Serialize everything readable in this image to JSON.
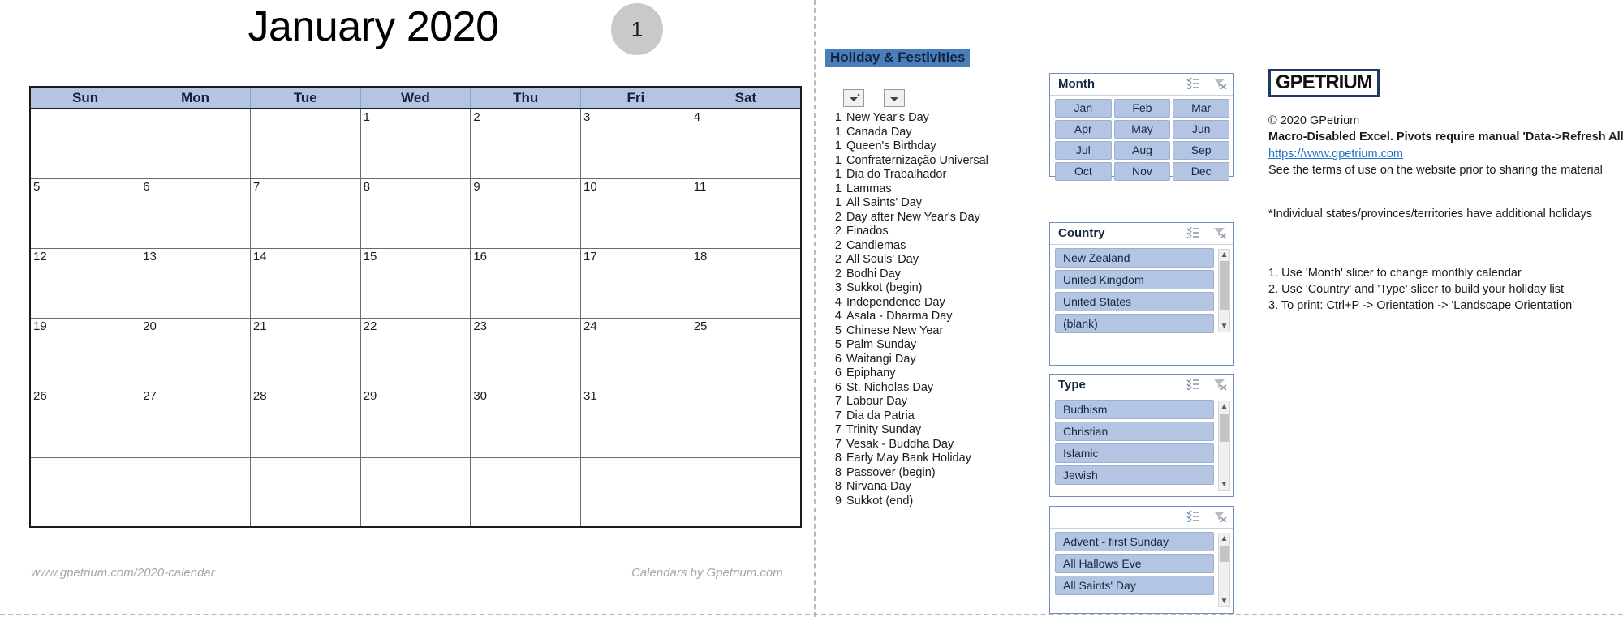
{
  "calendar": {
    "title": "January 2020",
    "month_number": "1",
    "weekday_headers": [
      "Sun",
      "Mon",
      "Tue",
      "Wed",
      "Thu",
      "Fri",
      "Sat"
    ],
    "weeks": [
      [
        "",
        "",
        "",
        "1",
        "2",
        "3",
        "4"
      ],
      [
        "5",
        "6",
        "7",
        "8",
        "9",
        "10",
        "11"
      ],
      [
        "12",
        "13",
        "14",
        "15",
        "16",
        "17",
        "18"
      ],
      [
        "19",
        "20",
        "21",
        "22",
        "23",
        "24",
        "25"
      ],
      [
        "26",
        "27",
        "28",
        "29",
        "30",
        "31",
        ""
      ],
      [
        "",
        "",
        "",
        "",
        "",
        "",
        ""
      ]
    ],
    "footer_left": "www.gpetrium.com/2020-calendar",
    "footer_right": "Calendars by Gpetrium.com"
  },
  "holidays": {
    "title": "Holiday & Festivities",
    "sort_filter_icon": "sort-filter-dropdown-icon",
    "filter_icon": "filter-dropdown-icon",
    "items": [
      {
        "day": "1",
        "name": "New Year's Day"
      },
      {
        "day": "1",
        "name": "Canada Day"
      },
      {
        "day": "1",
        "name": "Queen's Birthday"
      },
      {
        "day": "1",
        "name": "Confraternização Universal"
      },
      {
        "day": "1",
        "name": "Dia do Trabalhador"
      },
      {
        "day": "1",
        "name": "Lammas"
      },
      {
        "day": "1",
        "name": "All Saints' Day"
      },
      {
        "day": "2",
        "name": "Day after New Year's Day"
      },
      {
        "day": "2",
        "name": "Finados"
      },
      {
        "day": "2",
        "name": "Candlemas"
      },
      {
        "day": "2",
        "name": "All Souls' Day"
      },
      {
        "day": "2",
        "name": "Bodhi Day"
      },
      {
        "day": "3",
        "name": "Sukkot (begin)"
      },
      {
        "day": "4",
        "name": "Independence Day"
      },
      {
        "day": "4",
        "name": "Asala - Dharma Day"
      },
      {
        "day": "5",
        "name": "Chinese New Year"
      },
      {
        "day": "5",
        "name": "Palm Sunday"
      },
      {
        "day": "6",
        "name": "Waitangi Day"
      },
      {
        "day": "6",
        "name": "Epiphany"
      },
      {
        "day": "6",
        "name": "St. Nicholas Day"
      },
      {
        "day": "7",
        "name": "Labour Day"
      },
      {
        "day": "7",
        "name": "Dia da Patria"
      },
      {
        "day": "7",
        "name": "Trinity Sunday"
      },
      {
        "day": "7",
        "name": "Vesak - Buddha Day"
      },
      {
        "day": "8",
        "name": "Early May Bank Holiday"
      },
      {
        "day": "8",
        "name": "Passover (begin)"
      },
      {
        "day": "8",
        "name": "Nirvana Day"
      },
      {
        "day": "9",
        "name": "Sukkot (end)"
      }
    ]
  },
  "slicers": {
    "month": {
      "title": "Month",
      "multiselect_icon": "multi-select-icon",
      "clear_filter_icon": "clear-filter-icon",
      "items": [
        "Jan",
        "Feb",
        "Mar",
        "Apr",
        "May",
        "Jun",
        "Jul",
        "Aug",
        "Sep",
        "Oct",
        "Nov",
        "Dec"
      ]
    },
    "country": {
      "title": "Country",
      "multiselect_icon": "multi-select-icon",
      "clear_filter_icon": "clear-filter-icon",
      "items": [
        "New Zealand",
        "United Kingdom",
        "United States",
        "(blank)"
      ]
    },
    "type": {
      "title": "Type",
      "multiselect_icon": "multi-select-icon",
      "clear_filter_icon": "clear-filter-icon",
      "items": [
        "Budhism",
        "Christian",
        "Islamic",
        "Jewish"
      ]
    },
    "holiday_name": {
      "title": "",
      "multiselect_icon": "multi-select-icon",
      "clear_filter_icon": "clear-filter-icon",
      "items": [
        "Advent - first Sunday",
        "All Hallows Eve",
        "All Saints' Day"
      ]
    }
  },
  "info": {
    "logo": "GPETRIUM",
    "copyright": "© 2020 GPetrium",
    "macro_note": "Macro-Disabled Excel. Pivots require manual 'Data->Refresh All'",
    "website": "https://www.gpetrium.com",
    "terms": "See the terms of use on the website prior to sharing the material",
    "states_note": "*Individual states/provinces/territories have additional holidays",
    "step1": "1. Use 'Month' slicer to change monthly calendar",
    "step2": "2. Use 'Country' and 'Type' slicer to build your holiday list",
    "step3": "3. To print: Ctrl+P -> Orientation -> 'Landscape Orientation'"
  },
  "colors": {
    "header_blue": "#b4c5e4",
    "slicer_border": "#6f8fbf",
    "title_highlight": "#4a7ebb",
    "logo_navy": "#1f3864",
    "link_blue": "#1f6fc4"
  }
}
